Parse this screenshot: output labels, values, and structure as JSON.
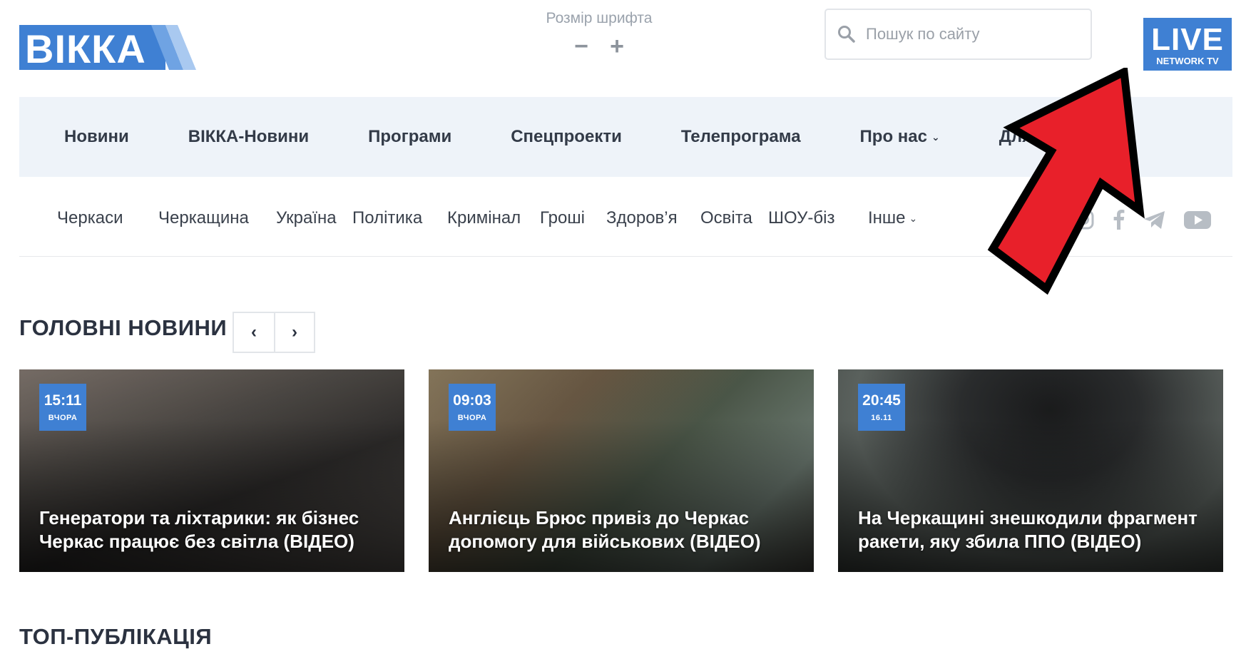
{
  "header": {
    "logo_text": "ВІККА",
    "font_size": {
      "label": "Розмір шрифта",
      "decrease": "−",
      "increase": "+"
    },
    "search": {
      "placeholder": "Пошук по сайту"
    },
    "live": {
      "main": "LIVE",
      "sub": "NETWORK TV"
    }
  },
  "main_nav": {
    "items": [
      {
        "label": "Новини"
      },
      {
        "label": "ВІККА-Новини"
      },
      {
        "label": "Програми"
      },
      {
        "label": "Спецпроекти"
      },
      {
        "label": "Телепрограма"
      },
      {
        "label": "Про нас",
        "dropdown": true
      },
      {
        "label": "Для партнерів"
      }
    ]
  },
  "categories": {
    "items": [
      {
        "label": "Черкаси"
      },
      {
        "label": "Черкащина"
      },
      {
        "label": "Україна"
      },
      {
        "label": "Політика"
      },
      {
        "label": "Кримінал"
      },
      {
        "label": "Гроші"
      },
      {
        "label": "Здоров’я"
      },
      {
        "label": "Освіта"
      },
      {
        "label": "ШОУ-біз"
      },
      {
        "label": "Інше",
        "dropdown": true
      }
    ],
    "social": [
      "instagram-icon",
      "facebook-icon",
      "telegram-icon",
      "youtube-icon"
    ]
  },
  "main_news": {
    "title": "ГОЛОВНІ НОВИНИ",
    "prev": "‹",
    "next": "›",
    "cards": [
      {
        "time": "15:11",
        "date": "ВЧОРА",
        "title": "Генератори та ліхтарики: як бізнес Черкас працює без світла (ВІДЕО)"
      },
      {
        "time": "09:03",
        "date": "ВЧОРА",
        "title": "Англієць Брюс привіз до Черкас допомогу для військових (ВІДЕО)"
      },
      {
        "time": "20:45",
        "date": "16.11",
        "title": "На Черкащині знешкодили фрагмент ракети, яку збила ППО (ВІДЕО)"
      }
    ]
  },
  "top_publication": {
    "title": "ТОП-ПУБЛІКАЦІЯ"
  },
  "colors": {
    "brand": "#3f80d3",
    "nav_bg": "#eef3f9",
    "annotation_arrow": "#e8202a"
  }
}
